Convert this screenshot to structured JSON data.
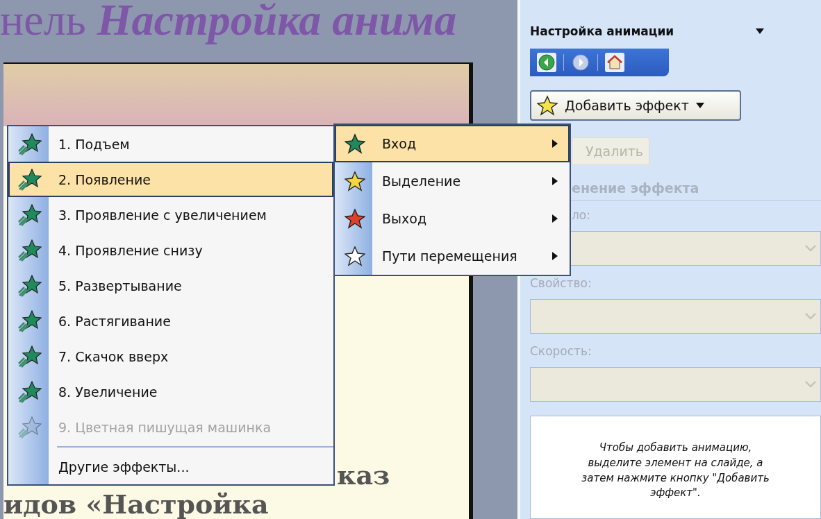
{
  "slide_title": {
    "lead": "нель",
    "emphasis": "Настройка анима"
  },
  "slide_text": [
    "каз",
    "идов «Настройка"
  ],
  "effects_menu": [
    {
      "kind": "effect",
      "label": "1. Подъем",
      "selected": false,
      "disabled": false
    },
    {
      "kind": "effect",
      "label": "2. Появление",
      "selected": true,
      "disabled": false
    },
    {
      "kind": "effect",
      "label": "3. Проявление с увеличением",
      "selected": false,
      "disabled": false
    },
    {
      "kind": "effect",
      "label": "4. Проявление снизу",
      "selected": false,
      "disabled": false
    },
    {
      "kind": "effect",
      "label": "5. Развертывание",
      "selected": false,
      "disabled": false
    },
    {
      "kind": "effect",
      "label": "6. Растягивание",
      "selected": false,
      "disabled": false
    },
    {
      "kind": "effect",
      "label": "7. Скачок вверх",
      "selected": false,
      "disabled": false
    },
    {
      "kind": "effect",
      "label": "8. Увеличение",
      "selected": false,
      "disabled": false
    },
    {
      "kind": "effect",
      "label": "9. Цветная пишущая машинка",
      "selected": false,
      "disabled": true
    },
    {
      "kind": "more",
      "label": "Другие эффекты...",
      "selected": false,
      "disabled": false
    }
  ],
  "category_menu": [
    {
      "label": "Вход",
      "selected": true,
      "color": "#1f8a5c"
    },
    {
      "label": "Выделение",
      "selected": false,
      "color": "#f2d640"
    },
    {
      "label": "Выход",
      "selected": false,
      "color": "#e0402a"
    },
    {
      "label": "Пути перемещения",
      "selected": false,
      "color": "#ffffff"
    }
  ],
  "task_pane": {
    "title": "Настройка анимации",
    "add_button": "Добавить эффект",
    "remove_button": "Удалить",
    "section": "енение эффекта",
    "fields": [
      {
        "label": "ло:",
        "partial": true
      },
      {
        "label": "Свойство:",
        "partial": false
      },
      {
        "label": "Скорость:",
        "partial": false
      }
    ],
    "hint": "Чтобы добавить анимацию, выделите элемент на слайде, а затем нажмите кнопку \"Добавить эффект\"."
  }
}
